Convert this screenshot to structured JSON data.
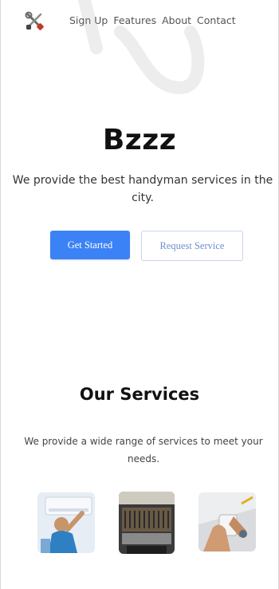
{
  "nav": {
    "logo_icon": "tools-icon",
    "links": [
      "Sign Up",
      "Features",
      "About",
      "Contact"
    ]
  },
  "hero": {
    "title": "Bzzz",
    "subtitle": "We provide the best handyman services in the city.",
    "primary_button": "Get Started",
    "secondary_button": "Request Service"
  },
  "services": {
    "title": "Our Services",
    "subtitle": "We provide a wide range of services to meet your needs.",
    "images": [
      "ac-repair-image",
      "vent-repair-image",
      "electrical-repair-image"
    ]
  },
  "colors": {
    "primary": "#3b82f6",
    "secondary_text": "#6f8fcf"
  }
}
